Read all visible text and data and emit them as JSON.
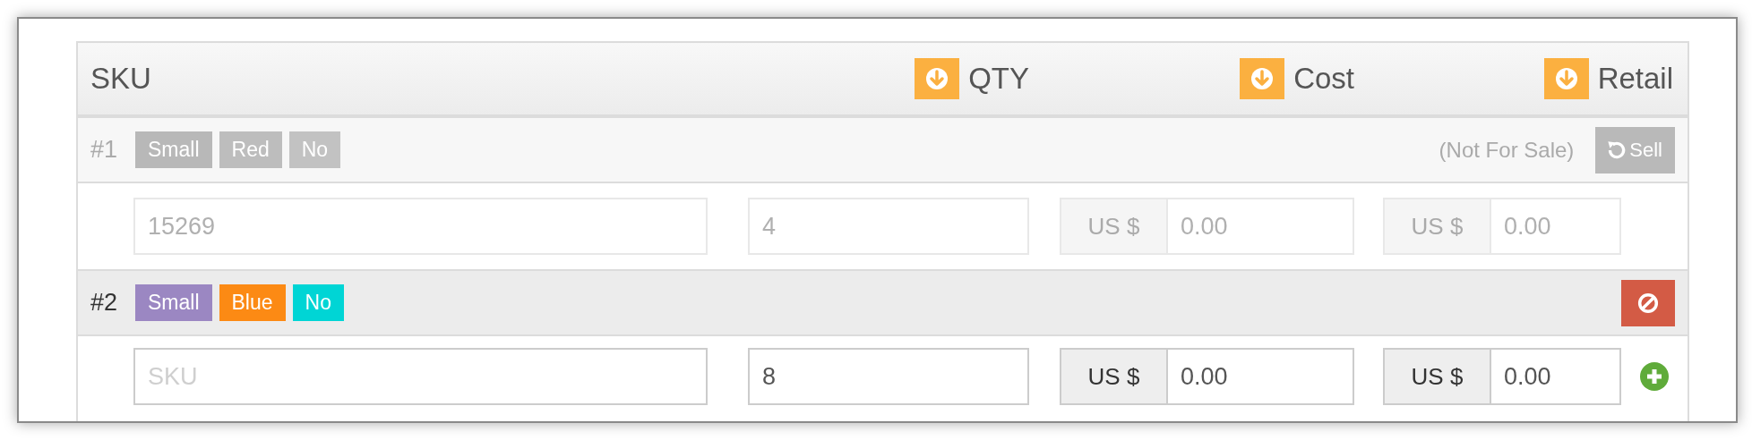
{
  "columns": [
    {
      "label": "SKU"
    },
    {
      "label": "QTY",
      "sort_icon": true
    },
    {
      "label": "Cost",
      "sort_icon": true
    },
    {
      "label": "Retail",
      "sort_icon": true
    }
  ],
  "variants": [
    {
      "number": "#1",
      "disabled": true,
      "tags": [
        {
          "label": "Small",
          "color": "#b8b8b8"
        },
        {
          "label": "Red",
          "color": "#bdbdbd"
        },
        {
          "label": "No",
          "color": "#c2c2c2"
        }
      ],
      "status": "(Not For Sale)",
      "action": {
        "kind": "sell",
        "label": "Sell"
      },
      "sku": {
        "value": "15269"
      },
      "qty": {
        "value": "4"
      },
      "cost": {
        "currency": "US $",
        "value": "0.00"
      },
      "retail": {
        "currency": "US $",
        "value": "0.00"
      }
    },
    {
      "number": "#2",
      "disabled": false,
      "tags": [
        {
          "label": "Small",
          "color": "#9b87c2"
        },
        {
          "label": "Blue",
          "color": "#fc8a14"
        },
        {
          "label": "No",
          "color": "#00d5d5"
        }
      ],
      "action": {
        "kind": "disable"
      },
      "sku": {
        "placeholder": "SKU"
      },
      "qty": {
        "value": "8"
      },
      "cost": {
        "currency": "US $",
        "value": "0.00"
      },
      "retail": {
        "currency": "US $",
        "value": "0.00"
      },
      "add_button": true
    }
  ]
}
